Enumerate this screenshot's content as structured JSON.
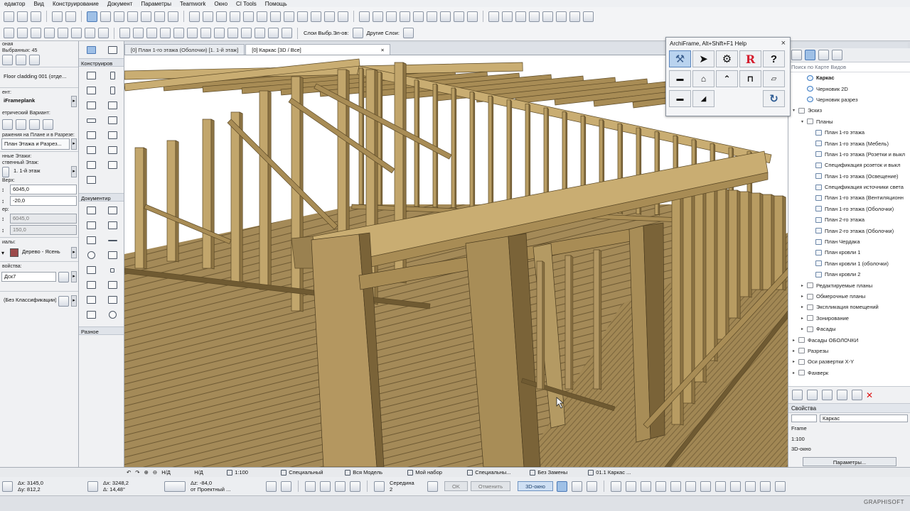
{
  "menu": [
    "едактор",
    "Вид",
    "Конструирование",
    "Документ",
    "Параметры",
    "Teamwork",
    "Окно",
    "CI Tools",
    "Помощь"
  ],
  "toolbar2": {
    "layers_label": "Слои Выбр.Эл-ов:",
    "other_layers_label": "Другие Слои:"
  },
  "infobox": {
    "label_selected": "оная",
    "selected_count": "Выбранных: 45",
    "element_name": "Floor cladding 001 (отде...",
    "label_element": "ент:",
    "element_type": "iFrameplank",
    "label_geom": "етрический Вариант:",
    "label_display": "ражения на Плане и в Разрезе:",
    "display_value": "План Этажа и Разрез...",
    "label_floors": "нные Этажи:",
    "label_home_floor": "ственный Этаж:",
    "home_floor": "1. 1-й этаж",
    "label_top": "Верх:",
    "top_value": "6045,0",
    "offset_value": "-20,0",
    "label_bottom": "ер:",
    "bottom_value": "6045,0",
    "bottom_offset": "150,0",
    "label_material": "иалы:",
    "material": "Дерево - Ясень",
    "label_props": "войства:",
    "prop_value": "Дск7",
    "classification": "(Без Классификации)"
  },
  "toolbox": {
    "sections": [
      "Конструиров",
      "Документир",
      "Разное"
    ]
  },
  "tabs": [
    {
      "label": "[0] План 1-го этажа (Оболочки) [1. 1-й этаж]",
      "active": false
    },
    {
      "label": "[0] Каркас [3D / Все]",
      "active": true,
      "close": "×"
    }
  ],
  "archiframe": {
    "title": "ArchiFrame, Alt+Shift+F1 Help",
    "close": "×",
    "help_glyph": "?",
    "r_glyph": "R",
    "refresh_glyph": "↻"
  },
  "navigator": {
    "search_placeholder": "Поиск по Карте Видов",
    "items": [
      {
        "label": "Каркас",
        "level": 1,
        "icon": "cam",
        "bold": true
      },
      {
        "label": "Черновик 2D",
        "level": 1,
        "icon": "cam"
      },
      {
        "label": "Черновик разрез",
        "level": 1,
        "icon": "cam"
      },
      {
        "label": "Эскиз",
        "level": 0,
        "icon": "fold",
        "expanded": true
      },
      {
        "label": "Планы",
        "level": 1,
        "icon": "fold",
        "expanded": true
      },
      {
        "label": "План 1-го этажа",
        "level": 2,
        "icon": "plan"
      },
      {
        "label": "План 1-го этажа (Мебель)",
        "level": 2,
        "icon": "plan"
      },
      {
        "label": "План 1-го этажа (Розетки и выкл",
        "level": 2,
        "icon": "plan"
      },
      {
        "label": "Спецификация розеток и выкл",
        "level": 2,
        "icon": "plan"
      },
      {
        "label": "План 1-го этажа (Освещение)",
        "level": 2,
        "icon": "plan"
      },
      {
        "label": "Спецификация источники света",
        "level": 2,
        "icon": "plan"
      },
      {
        "label": "План 1-го этажа (Вентиляционн",
        "level": 2,
        "icon": "plan"
      },
      {
        "label": "План 1-го этажа (Оболочки)",
        "level": 2,
        "icon": "plan"
      },
      {
        "label": "План 2-го этажа",
        "level": 2,
        "icon": "plan"
      },
      {
        "label": "План 2-го этажа (Оболочки)",
        "level": 2,
        "icon": "plan"
      },
      {
        "label": "План Чердака",
        "level": 2,
        "icon": "plan"
      },
      {
        "label": "План кровли 1",
        "level": 2,
        "icon": "plan"
      },
      {
        "label": "План кровли 1 (оболочки)",
        "level": 2,
        "icon": "plan"
      },
      {
        "label": "План кровли 2",
        "level": 2,
        "icon": "plan"
      },
      {
        "label": "Редактируемые планы",
        "level": 1,
        "icon": "fold"
      },
      {
        "label": "Обмерочные планы",
        "level": 1,
        "icon": "fold"
      },
      {
        "label": "Экспликация помещений",
        "level": 1,
        "icon": "fold"
      },
      {
        "label": "Зонирование",
        "level": 1,
        "icon": "fold"
      },
      {
        "label": "Фасады",
        "level": 1,
        "icon": "fold"
      },
      {
        "label": "Фасады ОБОЛОЧКИ",
        "level": 0,
        "icon": "fold"
      },
      {
        "label": "Разрезы",
        "level": 0,
        "icon": "fold"
      },
      {
        "label": "Оси развертки X-Y",
        "level": 0,
        "icon": "fold"
      },
      {
        "label": "Фахверк",
        "level": 0,
        "icon": "fold"
      }
    ],
    "properties_header": "Свойства",
    "prop_name": "Каркас",
    "prop_type": "Frame",
    "prop_scale": "1:100",
    "prop_window": "3D-окно",
    "params_button": "Параметры..."
  },
  "statusbar": {
    "nd1": "Н/Д",
    "nd2": "Н/Д",
    "scale": "1:100",
    "special": "Специальный",
    "model": "Вся Модель",
    "set": "Мой набор",
    "special2": "Специальны...",
    "override": "Без Замены",
    "view": "01.1 Каркас ..."
  },
  "coords": {
    "dx": "Δx: 3145,0",
    "dy": "Δy: 812,2",
    "ax": "Δx: 3248,2",
    "aang": "Δ: 14,48°",
    "az": "Δz: -84,0",
    "from_project": "от Проектный ...",
    "middle": "Середина",
    "middle_num": "2",
    "ok": "OK",
    "cancel": "Отменить",
    "threed": "3D-окно"
  },
  "footer_brand": "GRAPHISOFT",
  "colors": {
    "wood_light": "#c9ad72",
    "wood_mid": "#a88c55",
    "wood_dark": "#6f5a32",
    "floor": "#a48a58",
    "selection": "#9fc0e6"
  }
}
